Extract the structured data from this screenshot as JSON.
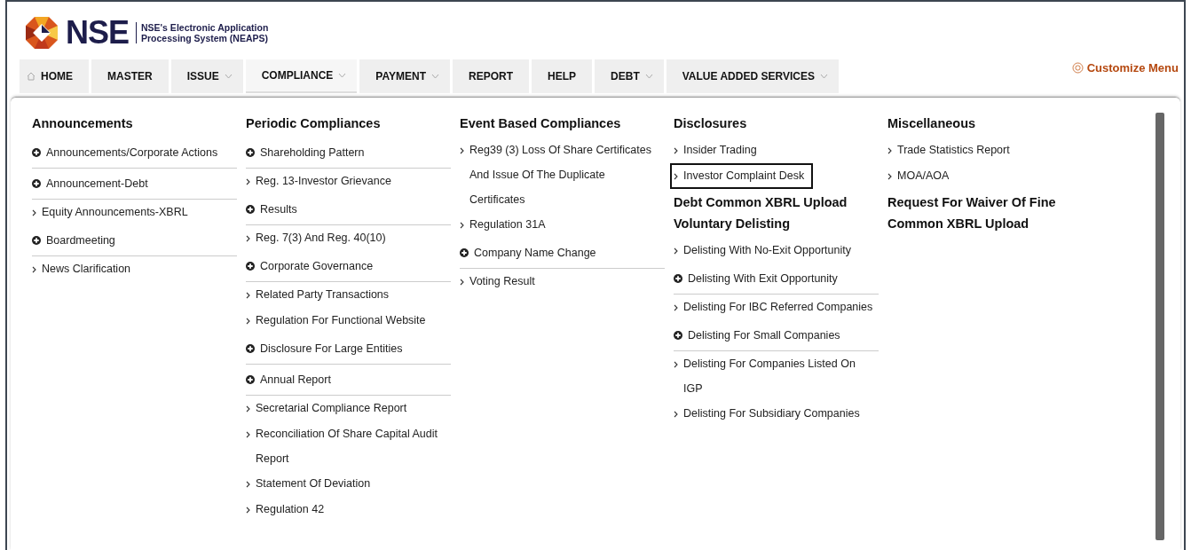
{
  "header": {
    "logo_text": "NSE",
    "subtitle_lines": [
      "NSE's Electronic Application",
      "Processing System (NEAPS)"
    ]
  },
  "nav": {
    "tabs": [
      {
        "label": "HOME",
        "kind": "home",
        "has_dropdown": false,
        "selected": false
      },
      {
        "label": "MASTER",
        "kind": "text",
        "has_dropdown": false,
        "selected": false
      },
      {
        "label": "ISSUE",
        "kind": "text",
        "has_dropdown": true,
        "selected": false
      },
      {
        "label": "COMPLIANCE",
        "kind": "text",
        "has_dropdown": true,
        "selected": true
      },
      {
        "label": "PAYMENT",
        "kind": "text",
        "has_dropdown": true,
        "selected": false
      },
      {
        "label": "REPORT",
        "kind": "text",
        "has_dropdown": false,
        "selected": false
      },
      {
        "label": "HELP",
        "kind": "text",
        "has_dropdown": false,
        "selected": false
      },
      {
        "label": "DEBT",
        "kind": "text",
        "has_dropdown": true,
        "selected": false
      },
      {
        "label": "VALUE ADDED SERVICES",
        "kind": "text",
        "has_dropdown": true,
        "selected": false
      }
    ],
    "customize_menu": "Customize Menu"
  },
  "menu": {
    "columns": [
      {
        "sections": [
          {
            "heading": "Announcements",
            "items": [
              {
                "label": "Announcements/Corporate Actions",
                "kind": "expand",
                "selected": false
              },
              {
                "label": "Announcement-Debt",
                "kind": "expand",
                "selected": false
              },
              {
                "label": "Equity Announcements-XBRL",
                "kind": "link",
                "selected": false
              },
              {
                "label": "Boardmeeting",
                "kind": "expand",
                "selected": false
              },
              {
                "label": "News Clarification",
                "kind": "link",
                "selected": false
              }
            ]
          }
        ]
      },
      {
        "sections": [
          {
            "heading": "Periodic Compliances",
            "items": [
              {
                "label": "Shareholding Pattern",
                "kind": "expand",
                "selected": false
              },
              {
                "label": "Reg. 13-Investor Grievance",
                "kind": "link",
                "selected": false
              },
              {
                "label": "Results",
                "kind": "expand",
                "selected": false
              },
              {
                "label": "Reg. 7(3) And Reg. 40(10)",
                "kind": "link",
                "selected": false
              },
              {
                "label": "Corporate Governance",
                "kind": "expand",
                "selected": false
              },
              {
                "label": "Related Party Transactions",
                "kind": "link",
                "selected": false
              },
              {
                "label": "Regulation For Functional Website",
                "kind": "link",
                "selected": false
              },
              {
                "label": "Disclosure For Large Entities",
                "kind": "expand",
                "selected": false
              },
              {
                "label": "Annual Report",
                "kind": "expand",
                "selected": false
              },
              {
                "label": "Secretarial Compliance Report",
                "kind": "link",
                "selected": false
              },
              {
                "label": "Reconciliation Of Share Capital Audit Report",
                "kind": "link",
                "selected": false
              },
              {
                "label": "Statement Of Deviation",
                "kind": "link",
                "selected": false
              },
              {
                "label": "Regulation 42",
                "kind": "link",
                "selected": false
              }
            ]
          }
        ]
      },
      {
        "sections": [
          {
            "heading": "Event Based Compliances",
            "items": [
              {
                "label": "Reg39 (3) Loss Of Share Certificates And Issue Of The Duplicate Certificates",
                "kind": "link",
                "selected": false
              },
              {
                "label": "Regulation 31A",
                "kind": "link",
                "selected": false
              },
              {
                "label": "Company Name Change",
                "kind": "expand",
                "selected": false
              },
              {
                "label": "Voting Result",
                "kind": "link",
                "selected": false
              }
            ]
          }
        ]
      },
      {
        "sections": [
          {
            "heading": "Disclosures",
            "items": [
              {
                "label": "Insider Trading",
                "kind": "link",
                "selected": false
              },
              {
                "label": "Investor Complaint Desk",
                "kind": "link",
                "selected": true
              }
            ]
          },
          {
            "heading": "Debt Common XBRL Upload"
          },
          {
            "heading": "Voluntary Delisting",
            "items": [
              {
                "label": "Delisting With No-Exit Opportunity",
                "kind": "link",
                "selected": false
              },
              {
                "label": "Delisting With Exit Opportunity",
                "kind": "expand",
                "selected": false
              },
              {
                "label": "Delisting For IBC Referred Companies",
                "kind": "link",
                "selected": false
              },
              {
                "label": "Delisting For Small Companies",
                "kind": "expand",
                "selected": false
              },
              {
                "label": "Delisting For Companies Listed On IGP",
                "kind": "link",
                "selected": false
              },
              {
                "label": "Delisting For Subsidiary Companies",
                "kind": "link",
                "selected": false
              }
            ]
          }
        ]
      },
      {
        "sections": [
          {
            "heading": "Miscellaneous",
            "items": [
              {
                "label": "Trade Statistics Report",
                "kind": "link",
                "selected": false
              },
              {
                "label": "MOA/AOA",
                "kind": "link",
                "selected": false
              }
            ]
          },
          {
            "heading": "Request For Waiver Of Fine"
          },
          {
            "heading": "Common XBRL Upload"
          }
        ]
      }
    ]
  }
}
